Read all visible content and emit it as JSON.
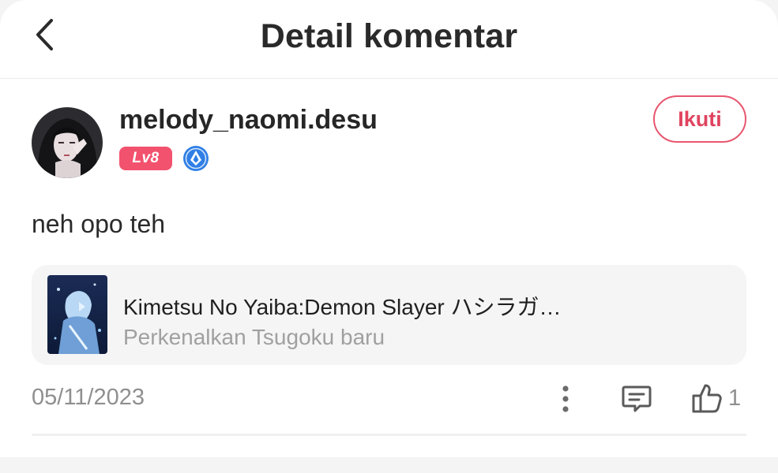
{
  "header": {
    "title": "Detail komentar",
    "back_icon": "chevron-left-icon"
  },
  "comment": {
    "username": "melody_naomi.desu",
    "level": "Lv8",
    "tier_icon": "diamond-tier-icon",
    "follow_label": "Ikuti",
    "text": "neh opo teh",
    "date": "05/11/2023",
    "like_count": "1"
  },
  "game_card": {
    "title": "Kimetsu No Yaiba:Demon Slayer ハシラガ…",
    "subtitle": "Perkenalkan Tsugoku baru"
  },
  "colors": {
    "accent": "#e8566f",
    "level_badge": "#f2526d",
    "tier_badge": "#2f7fe6",
    "muted_text": "#8f8f8f"
  }
}
